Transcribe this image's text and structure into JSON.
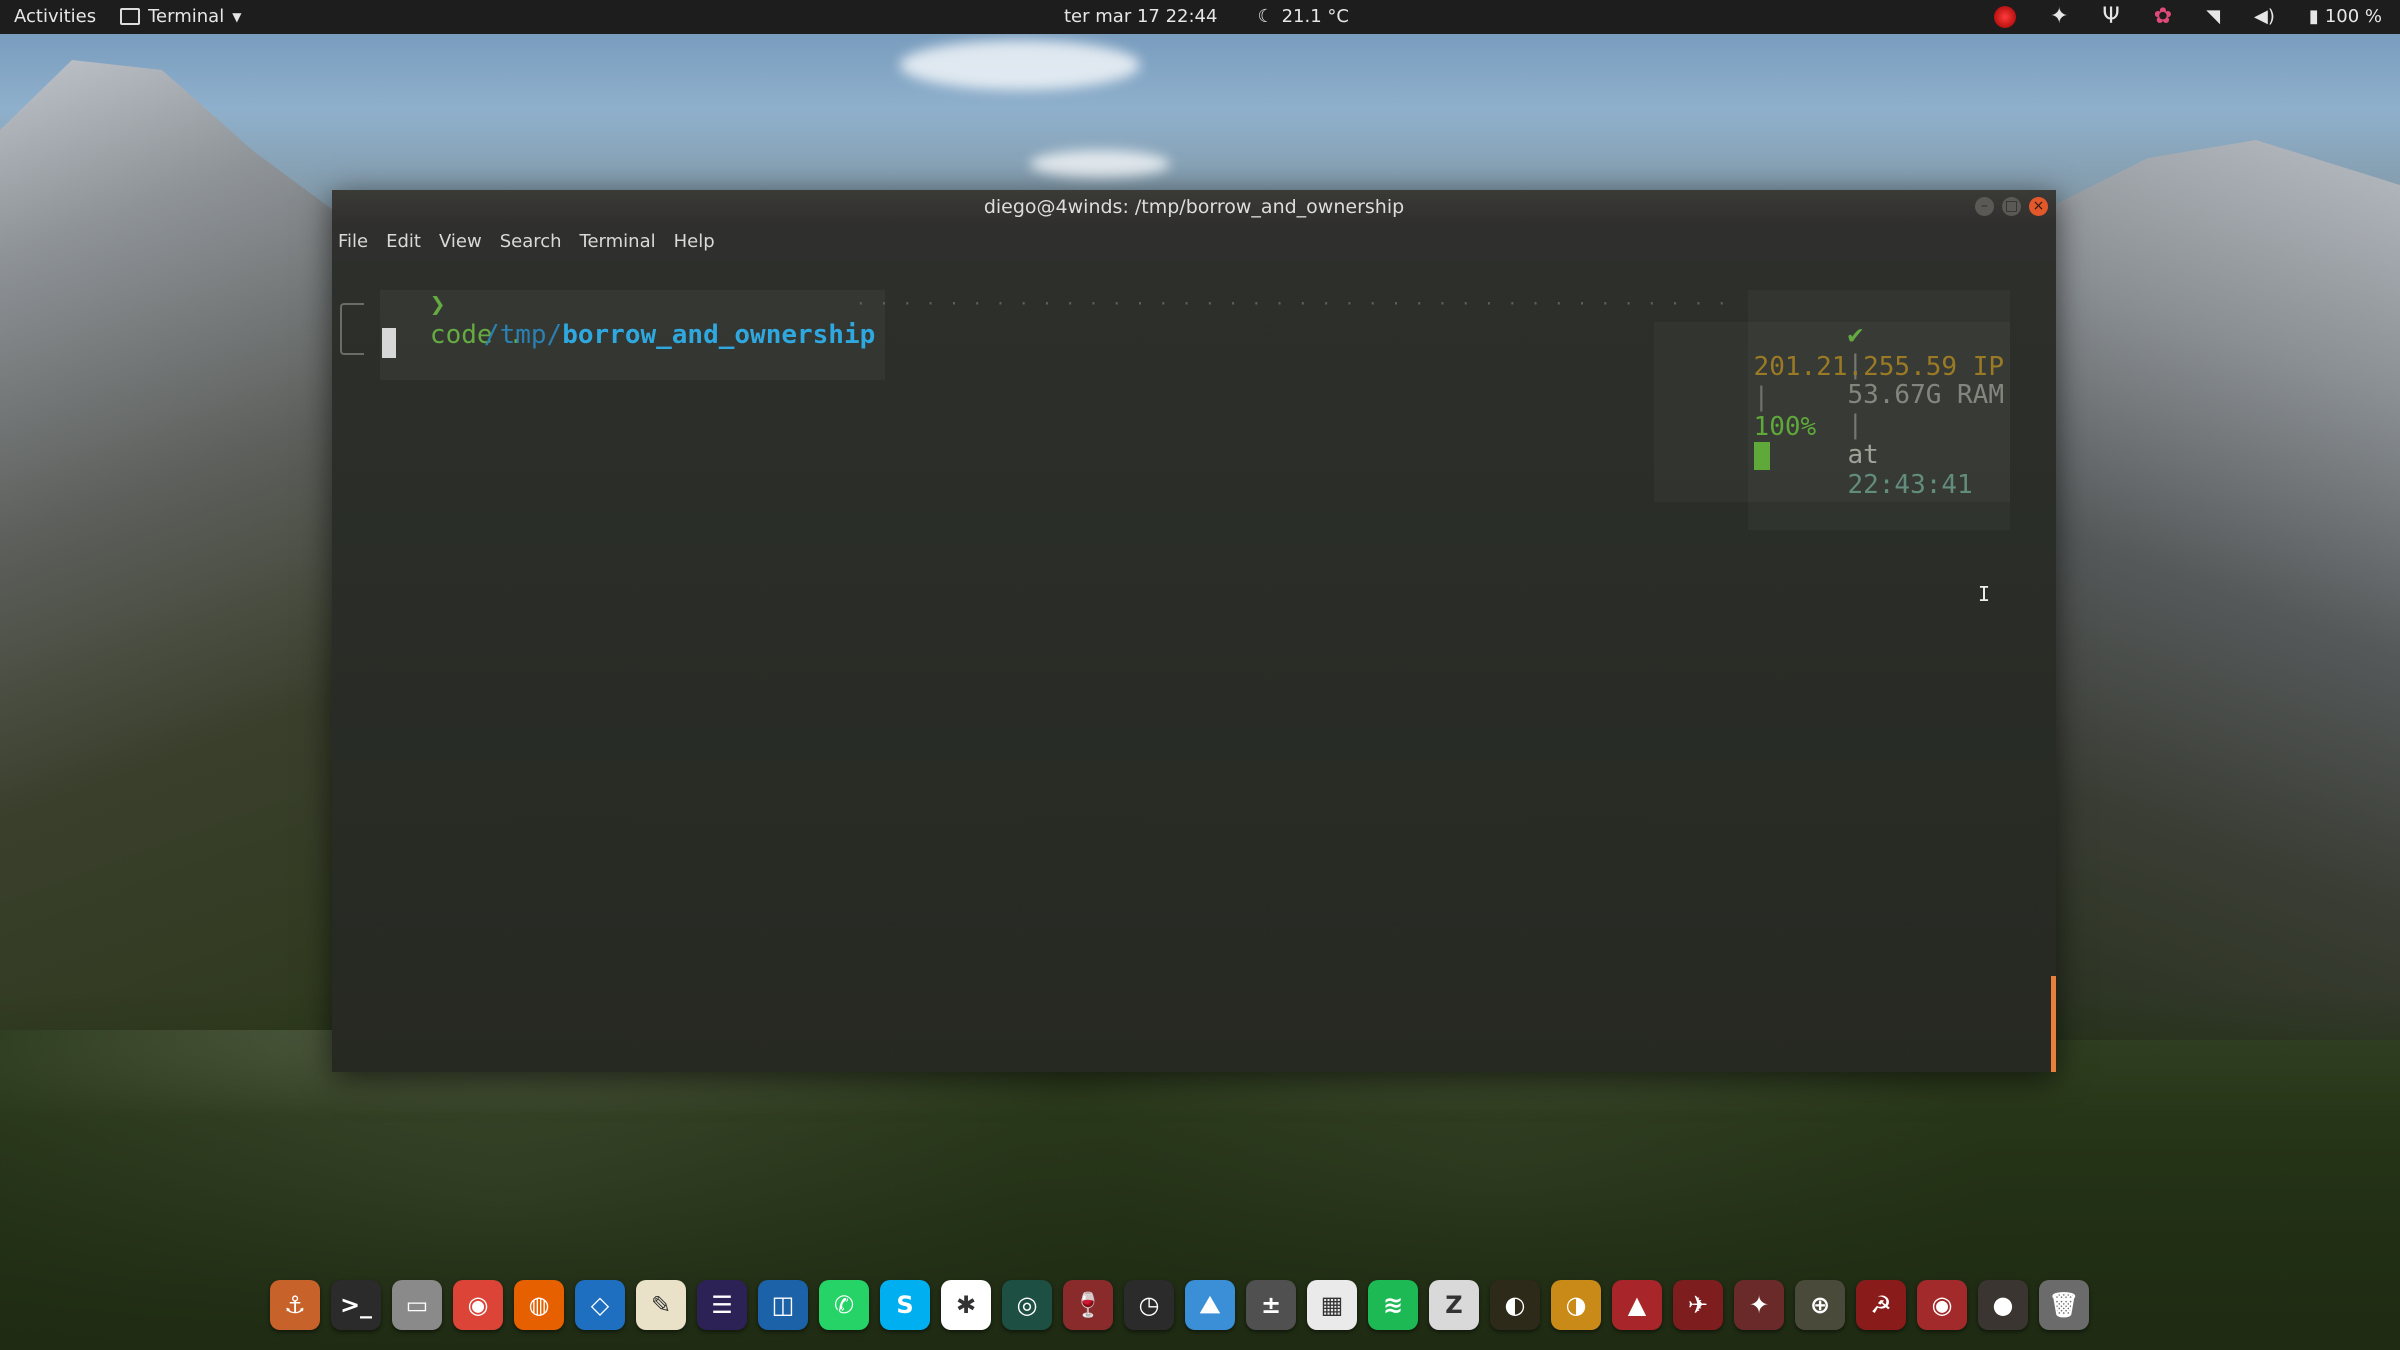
{
  "topbar": {
    "activities": "Activities",
    "app_name": "Terminal",
    "datetime": "ter mar 17  22:44",
    "weather": "21.1 °C",
    "battery": "100 %"
  },
  "window": {
    "title": "diego@4winds: /tmp/borrow_and_ownership",
    "menu": [
      "File",
      "Edit",
      "View",
      "Search",
      "Terminal",
      "Help"
    ]
  },
  "terminal": {
    "prompt_char": "❯",
    "command": "code .",
    "path_prefix": "/tmp/",
    "path_dir": "borrow_and_ownership",
    "dots": "· · · · · · · · · · · · · · · · · · · · · · · · · · · · · · · · · · · · · ·",
    "status_check": "✔",
    "ram": "53.67G RAM",
    "at_label": "at",
    "time": "22:43:41",
    "ip": "201.21.255.59 IP",
    "battery": "100%"
  },
  "colors": {
    "prompt_green": "#5fa83a",
    "path_blue": "#2fa8e0",
    "muted": "#8a8f86",
    "ip_orange": "#9a7a24",
    "accent_orange": "#e8803c"
  },
  "dock": [
    {
      "name": "anchor-icon",
      "bg": "#c7622a",
      "glyph": "⚓"
    },
    {
      "name": "terminal-icon",
      "bg": "#2b2b2b",
      "glyph": ">_"
    },
    {
      "name": "files-icon",
      "bg": "#8a8a8a",
      "glyph": "▭"
    },
    {
      "name": "chrome-icon",
      "bg": "#db4437",
      "glyph": "◉"
    },
    {
      "name": "firefox-icon",
      "bg": "#e66000",
      "glyph": "◍"
    },
    {
      "name": "vscode-icon",
      "bg": "#1f6fc0",
      "glyph": "◇"
    },
    {
      "name": "text-editor-icon",
      "bg": "#e9e2c8",
      "glyph": "✎"
    },
    {
      "name": "eclipse-icon",
      "bg": "#2c2255",
      "glyph": "☰"
    },
    {
      "name": "virtualbox-icon",
      "bg": "#1b62a8",
      "glyph": "◫"
    },
    {
      "name": "whatsapp-icon",
      "bg": "#25d366",
      "glyph": "✆"
    },
    {
      "name": "skype-icon",
      "bg": "#00aff0",
      "glyph": "S"
    },
    {
      "name": "slack-icon",
      "bg": "#ffffff",
      "glyph": "✱"
    },
    {
      "name": "globe-icon",
      "bg": "#1e4f43",
      "glyph": "◎"
    },
    {
      "name": "wine-icon",
      "bg": "#8a2b2b",
      "glyph": "🍷"
    },
    {
      "name": "clock-icon",
      "bg": "#2b2b2b",
      "glyph": "◷"
    },
    {
      "name": "monitor-icon",
      "bg": "#3a8fd6",
      "glyph": "⛰"
    },
    {
      "name": "calculator-icon",
      "bg": "#505050",
      "glyph": "±"
    },
    {
      "name": "apps-grid-icon",
      "bg": "#eaeaea",
      "glyph": "▦"
    },
    {
      "name": "spotify-icon",
      "bg": "#1db954",
      "glyph": "≋"
    },
    {
      "name": "zsnes-icon",
      "bg": "#d9d9d9",
      "glyph": "Z"
    },
    {
      "name": "mortal-kombat-icon",
      "bg": "#2e2a1a",
      "glyph": "◐"
    },
    {
      "name": "dragon-icon",
      "bg": "#c98a18",
      "glyph": "◑"
    },
    {
      "name": "game-red-icon",
      "bg": "#a8262a",
      "glyph": "▲"
    },
    {
      "name": "plane-icon",
      "bg": "#7e1d1d",
      "glyph": "✈"
    },
    {
      "name": "wing-icon",
      "bg": "#6a2a2a",
      "glyph": "✦"
    },
    {
      "name": "crosshair-icon",
      "bg": "#4a4a3a",
      "glyph": "⊕"
    },
    {
      "name": "hammer-sickle-icon",
      "bg": "#8a1b1b",
      "glyph": "☭"
    },
    {
      "name": "target-icon",
      "bg": "#a32a2a",
      "glyph": "◉"
    },
    {
      "name": "sphere-icon",
      "bg": "#3a3530",
      "glyph": "●"
    },
    {
      "name": "trash-icon",
      "bg": "#6b6b6b",
      "glyph": "🗑"
    }
  ]
}
